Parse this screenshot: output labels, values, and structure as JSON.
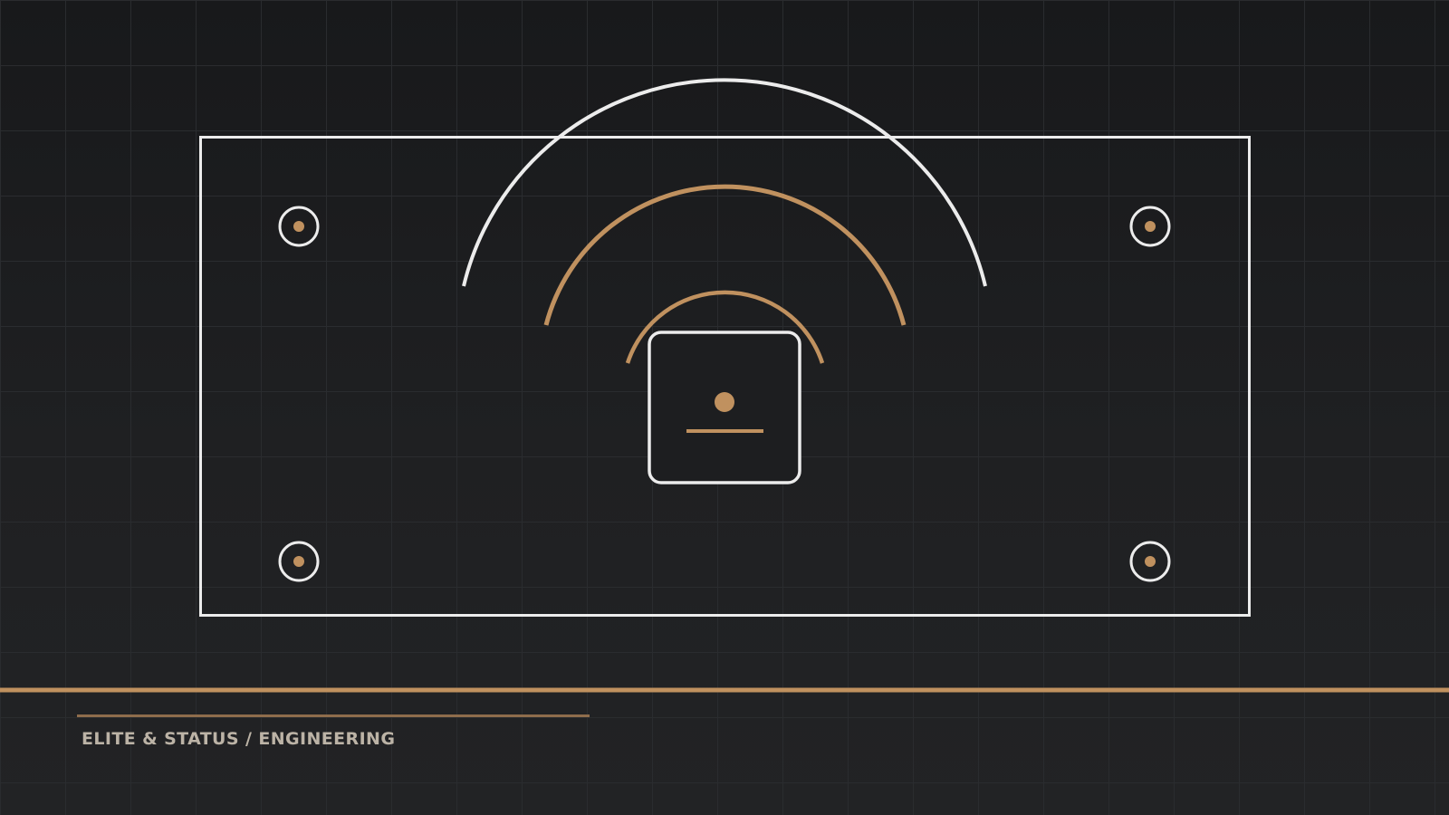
{
  "caption": {
    "text": "ELITE & STATUS / ENGINEERING"
  },
  "palette": {
    "line_white": "#ececec",
    "accent_bronze": "#c0915f",
    "accent_bronze_dim": "#8e6d4c",
    "caption_text": "#bcb3a6",
    "grid_line": "#2a2c2f"
  },
  "icons": {
    "central_symbol": "signal-broadcast-icon",
    "corner_marker": "target-dot-icon"
  }
}
